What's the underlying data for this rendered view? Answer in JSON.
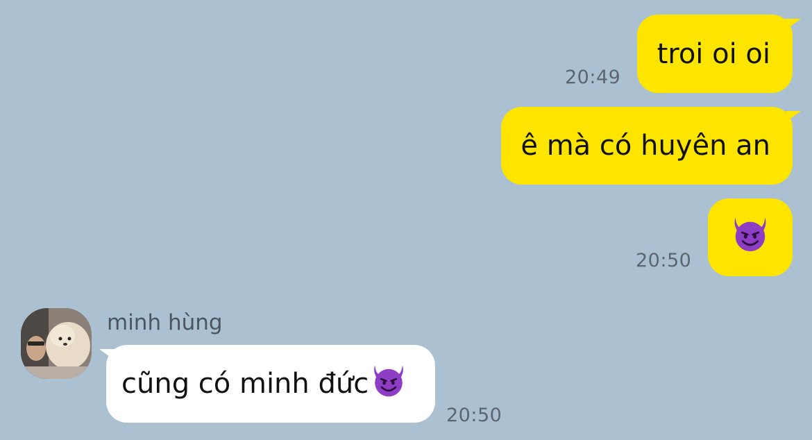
{
  "messages": [
    {
      "side": "sent",
      "text": "troi oi oi",
      "time": "20:49"
    },
    {
      "side": "sent",
      "text": "ê mà có huyên an",
      "time": ""
    },
    {
      "side": "sent",
      "emoji": "smiling-face-with-horns",
      "time": "20:50"
    },
    {
      "side": "received",
      "sender": "minh hùng",
      "text": "cũng có minh đức",
      "emoji": "smiling-face-with-horns",
      "time": "20:50"
    }
  ],
  "colors": {
    "background": "#abc1d1",
    "sent_bubble": "#fee500",
    "received_bubble": "#ffffff",
    "emoji_purple": "#8e3ec4"
  }
}
